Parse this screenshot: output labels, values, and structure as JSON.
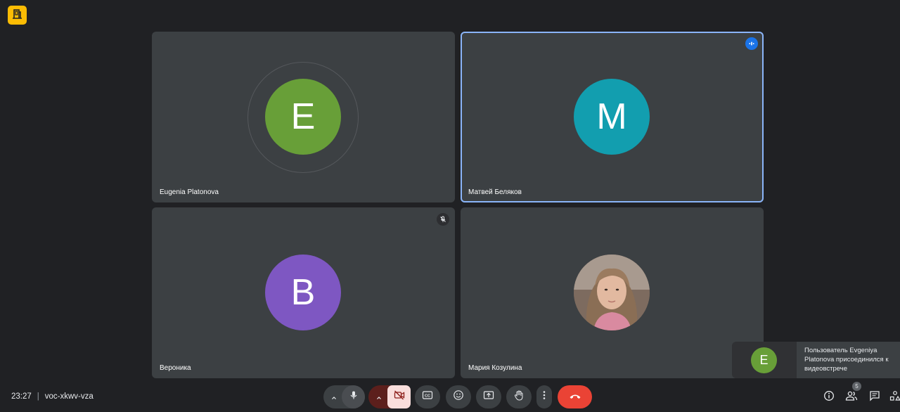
{
  "app": {
    "logo_icon": "meet-door-icon",
    "accent": "#fbbc04"
  },
  "tiles": [
    {
      "name": "Eugenia Platonova",
      "initial": "E",
      "avatar_color": "#689f38",
      "speaking_ring": true
    },
    {
      "name": "Матвей Беляков",
      "initial": "M",
      "avatar_color": "#129eaf",
      "active_speaker": true,
      "badge_icon": "audio-level-icon"
    },
    {
      "name": "Вероника",
      "initial": "B",
      "avatar_color": "#7e57c2",
      "badge_icon": "mic-off-icon"
    },
    {
      "name": "Мария Козулина",
      "avatar_icon": "profile-photo"
    }
  ],
  "notification": {
    "initial": "E",
    "message": "Пользователь Evgeniya Platonova присоединился к видеовстрече"
  },
  "footer": {
    "time": "23:27",
    "separator": "|",
    "meeting_code": "voc-xkwv-vza",
    "participant_count": "5"
  },
  "controls": {
    "mic_options": "chevron-up-icon",
    "mic": "mic-icon",
    "camera_options": "chevron-up-icon",
    "camera": "camera-off-icon",
    "captions": "captions-icon",
    "emoji": "emoji-icon",
    "present": "present-icon",
    "hand": "raise-hand-icon",
    "more": "more-vert-icon",
    "end_call": "end-call-icon",
    "end_call_color": "#ea4335",
    "camera_off_bg": "#f9dedc"
  }
}
